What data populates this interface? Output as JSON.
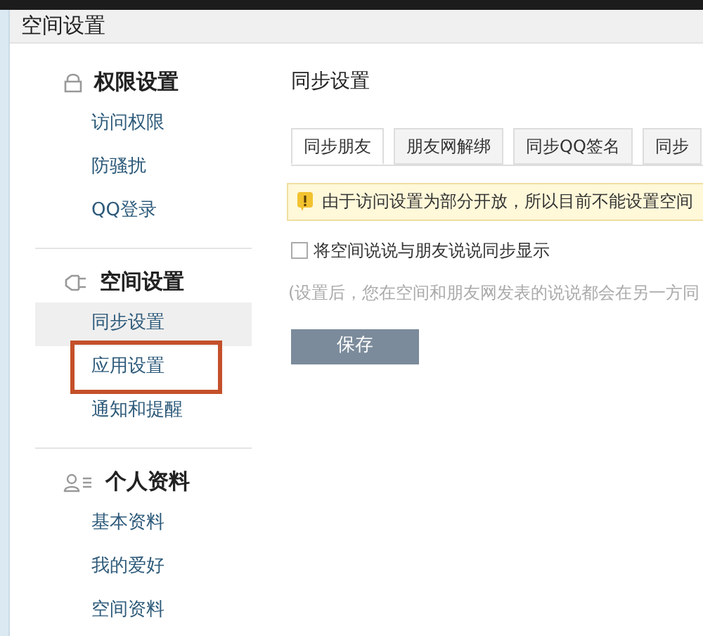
{
  "page": {
    "title": "空间设置"
  },
  "sidebar": {
    "sections": [
      {
        "title": "权限设置",
        "items": [
          {
            "label": "访问权限",
            "selected": false,
            "highlighted": false
          },
          {
            "label": "防骚扰",
            "selected": false,
            "highlighted": false
          },
          {
            "label": "QQ登录",
            "selected": false,
            "highlighted": false
          }
        ]
      },
      {
        "title": "空间设置",
        "items": [
          {
            "label": "同步设置",
            "selected": true,
            "highlighted": false
          },
          {
            "label": "应用设置",
            "selected": false,
            "highlighted": true
          },
          {
            "label": "通知和提醒",
            "selected": false,
            "highlighted": false
          }
        ]
      },
      {
        "title": "个人资料",
        "items": [
          {
            "label": "基本资料",
            "selected": false,
            "highlighted": false
          },
          {
            "label": "我的爱好",
            "selected": false,
            "highlighted": false
          },
          {
            "label": "空间资料",
            "selected": false,
            "highlighted": false
          }
        ]
      }
    ]
  },
  "main": {
    "title": "同步设置",
    "tabs": [
      {
        "label": "同步朋友",
        "selected": true
      },
      {
        "label": "朋友网解绑",
        "selected": false
      },
      {
        "label": "同步QQ签名",
        "selected": false
      },
      {
        "label": "同步",
        "selected": false
      }
    ],
    "warning": "由于访问设置为部分开放，所以目前不能设置空间",
    "checkbox": {
      "label": "将空间说说与朋友说说同步显示",
      "checked": false
    },
    "hint": "(设置后，您在空间和朋友网发表的说说都会在另一方同",
    "save_button": "保存"
  }
}
